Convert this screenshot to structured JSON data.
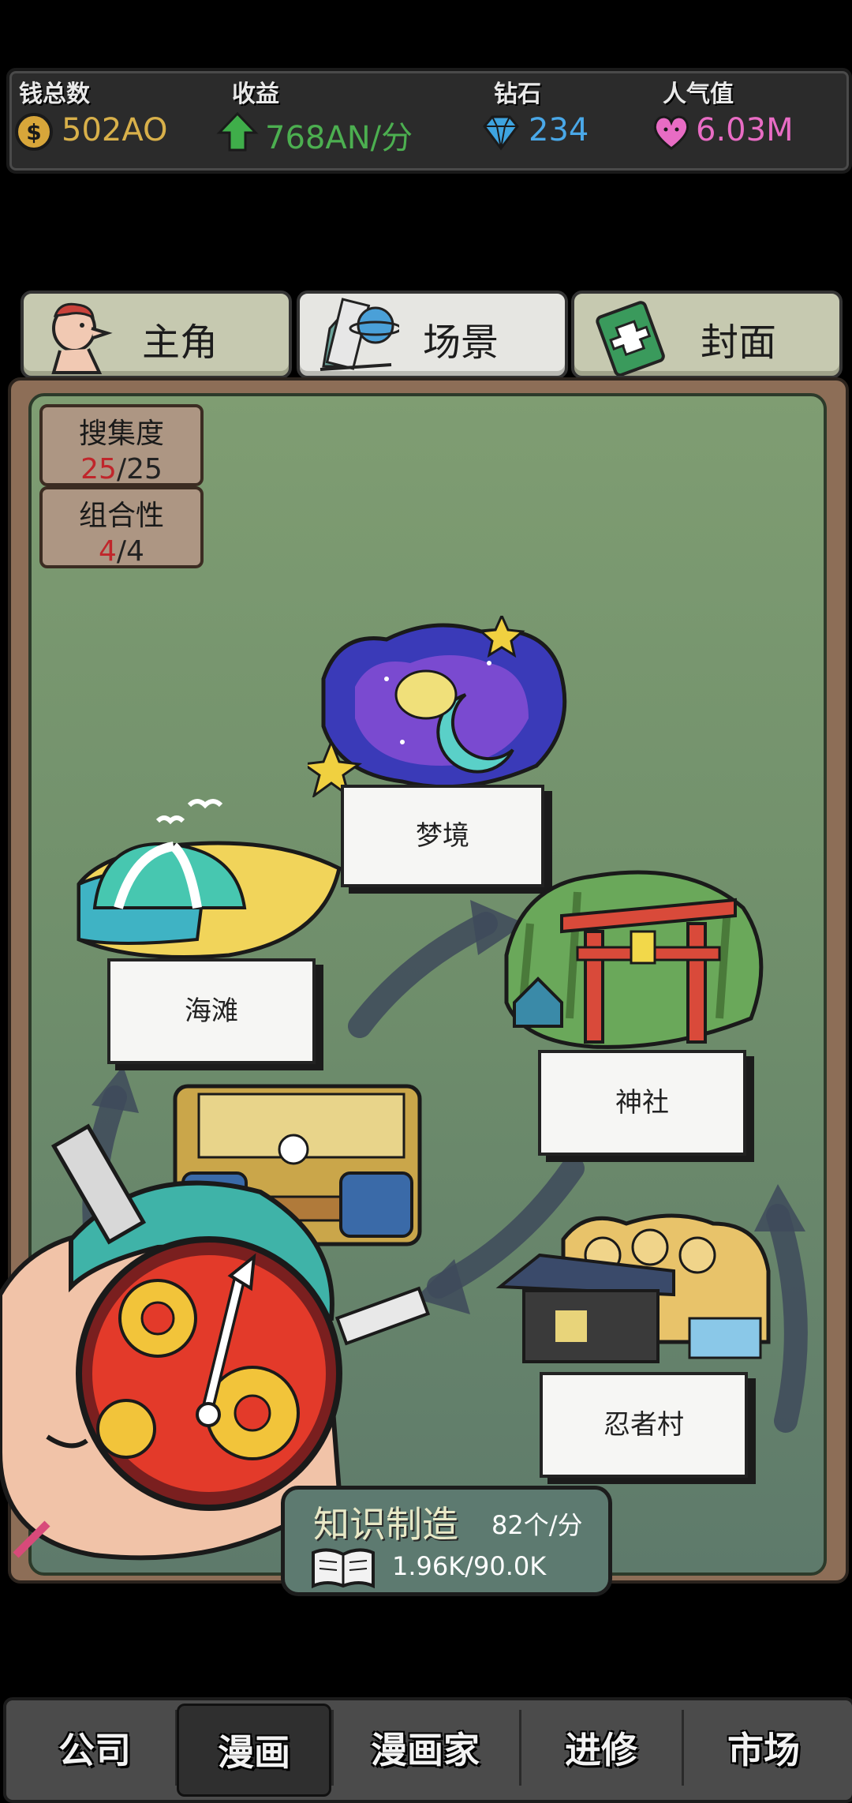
{
  "stats": {
    "money": {
      "label": "钱总数",
      "value": "502AO",
      "icon": "coin-icon",
      "color": "#d8b04a"
    },
    "income": {
      "label": "收益",
      "value": "768AN/分",
      "icon": "up-arrow-icon",
      "color": "#4caf50"
    },
    "diamonds": {
      "label": "钻石",
      "value": "234",
      "icon": "diamond-icon",
      "color": "#4aa8e8"
    },
    "popularity": {
      "label": "人气值",
      "value": "6.03M",
      "icon": "heart-icon",
      "color": "#e86cc4"
    }
  },
  "tabs": [
    {
      "label": "主角",
      "icon": "character-icon",
      "active": false
    },
    {
      "label": "场景",
      "icon": "scene-icon",
      "active": true
    },
    {
      "label": "封面",
      "icon": "cover-book-icon",
      "active": false
    }
  ],
  "collection": {
    "title": "搜集度",
    "current": "25",
    "total": "/25"
  },
  "combination": {
    "title": "组合性",
    "current": "4",
    "total": "/4"
  },
  "scenes": [
    {
      "label": "梦境",
      "art": "dream-art"
    },
    {
      "label": "海滩",
      "art": "beach-art"
    },
    {
      "label": "神社",
      "art": "shrine-art"
    },
    {
      "label": "忍者村",
      "art": "ninja-village-art"
    }
  ],
  "knowledge": {
    "title": "知识制造",
    "rate": "82个/分",
    "progress": "1.96K/90.0K"
  },
  "nav": [
    {
      "label": "公司",
      "active": false
    },
    {
      "label": "漫画",
      "active": true
    },
    {
      "label": "漫画家",
      "active": false
    },
    {
      "label": "进修",
      "active": false
    },
    {
      "label": "市场",
      "active": false
    }
  ]
}
